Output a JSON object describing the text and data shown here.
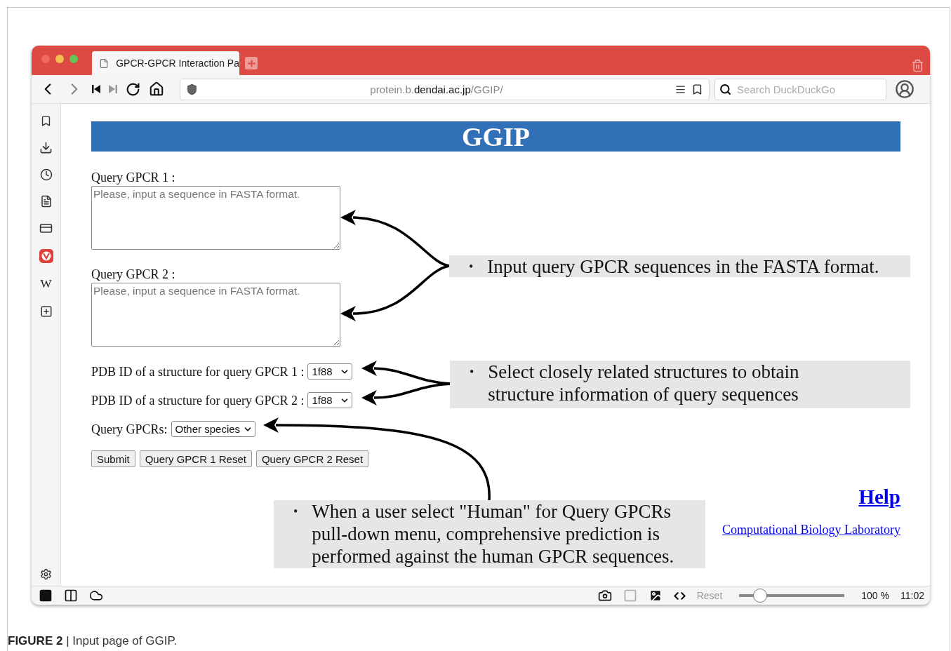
{
  "browser": {
    "tab": {
      "title": "GPCR-GPCR Interaction Pa",
      "selected": true
    },
    "url": {
      "host_prefix": "protein.b.",
      "domain": "dendai.ac.jp",
      "path": "/GGIP/"
    },
    "search": {
      "placeholder": "Search DuckDuckGo"
    },
    "sidebar_letter": "W"
  },
  "page": {
    "title": "GGIP",
    "queries": [
      {
        "label": "Query GPCR 1 :",
        "placeholder": "Please, input a sequence in FASTA format."
      },
      {
        "label": "Query GPCR 2 :",
        "placeholder": "Please, input a sequence in FASTA format."
      }
    ],
    "pdb_selects": [
      {
        "label": "PDB ID of a structure for query GPCR 1 :",
        "value": "1f88"
      },
      {
        "label": "PDB ID of a structure for query GPCR 2 :",
        "value": "1f88"
      }
    ],
    "species": {
      "label": "Query GPCRs:",
      "value": "Other species"
    },
    "buttons": [
      "Submit",
      "Query GPCR 1 Reset",
      "Query GPCR 2 Reset"
    ],
    "links": [
      {
        "text": "Help",
        "kind": "large"
      },
      {
        "text": "Computational Biology Laboratory",
        "kind": "small"
      }
    ]
  },
  "annotations": [
    {
      "bullet": "•",
      "text": "Input query GPCR sequences in the FASTA format."
    },
    {
      "bullet": "•",
      "text": "Select closely related structures to obtain\nstructure information of query sequences"
    },
    {
      "bullet": "•",
      "text": "When a user select \"Human\" for Query GPCRs\npull-down menu, comprehensive prediction is\nperformed against the human GPCR sequences."
    }
  ],
  "status_bar": {
    "reset": "Reset",
    "zoom": {
      "level": 0.2
    },
    "zoom_text": "100 %",
    "time": "11:02"
  },
  "caption": "**FIGURE 2** | Input page of GGIP."
}
